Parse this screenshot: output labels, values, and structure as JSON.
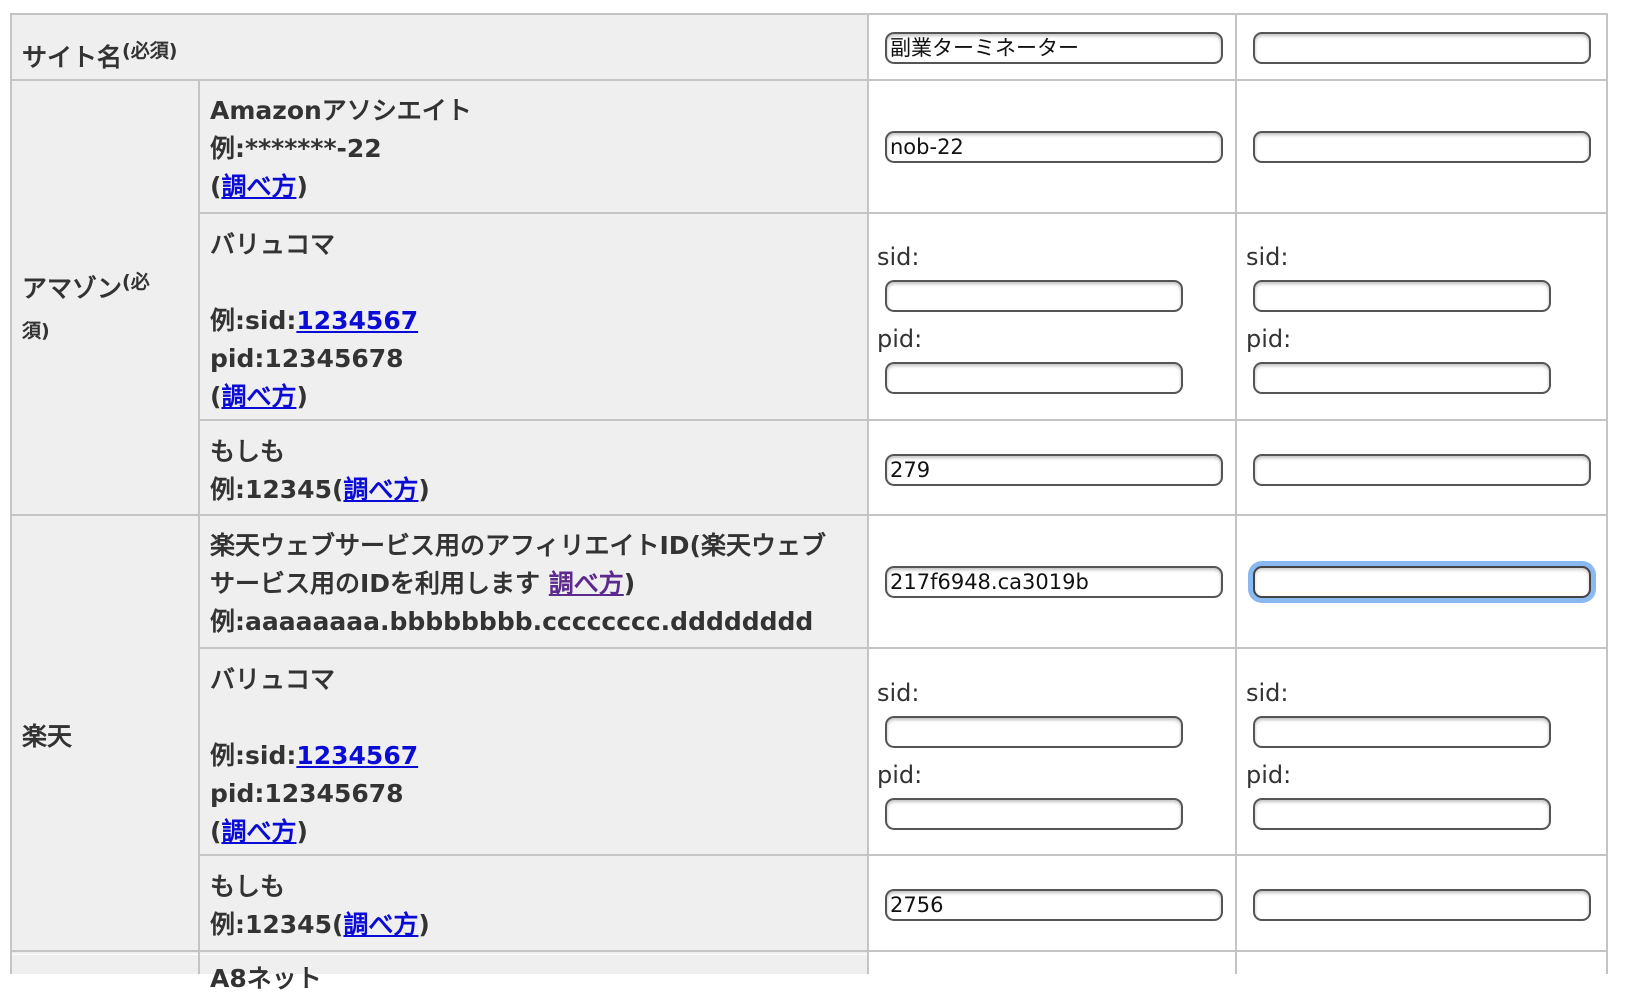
{
  "rows": {
    "site_name": {
      "label": "サイト名",
      "required": "(必須)",
      "value1": "副業ターミネーター",
      "value2": ""
    },
    "amazon": {
      "group_label": "アマゾン",
      "group_required_1": "(必",
      "group_required_2": "須)",
      "associate": {
        "title": "Amazonアソシエイト",
        "example": "例:*******-22",
        "howto_open": "(",
        "howto_link": "調べ方",
        "howto_close": ")",
        "value1": "nob-22",
        "value2": ""
      },
      "valuecommerce": {
        "title": "バリュコマ",
        "example_prefix": "例:sid:",
        "example_sid_link": "1234567",
        "example_pid": "pid:12345678",
        "howto_open": "(",
        "howto_link": "調べ方",
        "howto_close": ")",
        "sid_label": "sid:",
        "pid_label": "pid:",
        "sid1": "",
        "pid1": "",
        "sid2": "",
        "pid2": ""
      },
      "moshimo": {
        "title": "もしも",
        "example": "例:12345(",
        "howto_link": "調べ方",
        "howto_close": ")",
        "value1": "279",
        "value2": ""
      }
    },
    "rakuten": {
      "group_label": "楽天",
      "webservice": {
        "title_line1": "楽天ウェブサービス用のアフィリエイトID(楽天ウェブ",
        "title_line2": "サービス用のIDを利用します ",
        "howto_link": "調べ方",
        "howto_close": ")",
        "example": "例:aaaaaaaa.bbbbbbbb.cccccccc.dddddddd",
        "value1": "217f6948.ca3019b",
        "value2": ""
      },
      "valuecommerce": {
        "title": "バリュコマ",
        "example_prefix": "例:sid:",
        "example_sid_link": "1234567",
        "example_pid": "pid:12345678",
        "howto_open": "(",
        "howto_link": "調べ方",
        "howto_close": ")",
        "sid_label": "sid:",
        "pid_label": "pid:",
        "sid1": "",
        "pid1": "",
        "sid2": "",
        "pid2": ""
      },
      "moshimo": {
        "title": "もしも",
        "example": "例:12345(",
        "howto_link": "調べ方",
        "howto_close": ")",
        "value1": "2756",
        "value2": ""
      }
    },
    "next_row_partial": {
      "label": "A8ネット"
    }
  }
}
